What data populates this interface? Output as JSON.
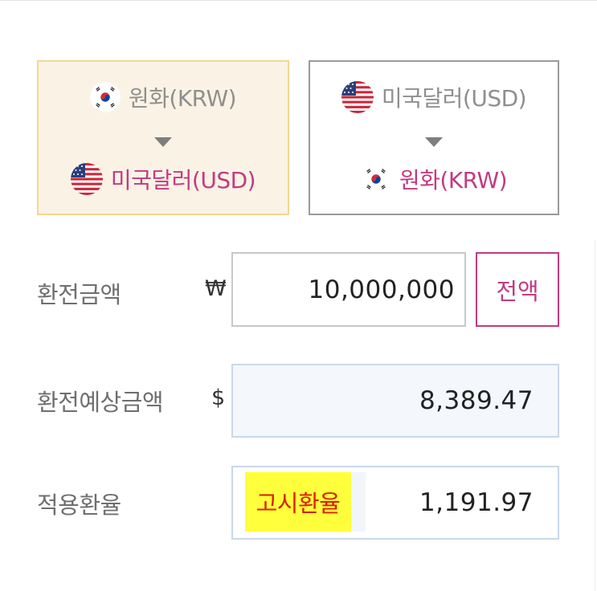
{
  "directions": {
    "krw_to_usd": {
      "from_label": "원화(KRW)",
      "from_flag_icon": "kr-flag-icon",
      "to_label": "미국달러(USD)",
      "to_flag_icon": "us-flag-icon",
      "selected": true
    },
    "usd_to_krw": {
      "from_label": "미국달러(USD)",
      "from_flag_icon": "us-flag-icon",
      "to_label": "원화(KRW)",
      "to_flag_icon": "kr-flag-icon",
      "selected": false
    }
  },
  "amount": {
    "label": "환전금액",
    "unit": "₩",
    "value": "10,000,000",
    "full_button": "전액"
  },
  "expected": {
    "label": "환전예상금액",
    "unit": "$",
    "value": "8,389.47"
  },
  "rate": {
    "label": "적용환율",
    "badge": "고시환율",
    "value": "1,191.97"
  },
  "colors": {
    "accent": "#c23b82",
    "selected_bg": "#faf3e5",
    "selected_border": "#f3d692",
    "badge_bg": "#ffff3c",
    "badge_text": "#d62200",
    "result_bg": "#f4f8fd"
  }
}
